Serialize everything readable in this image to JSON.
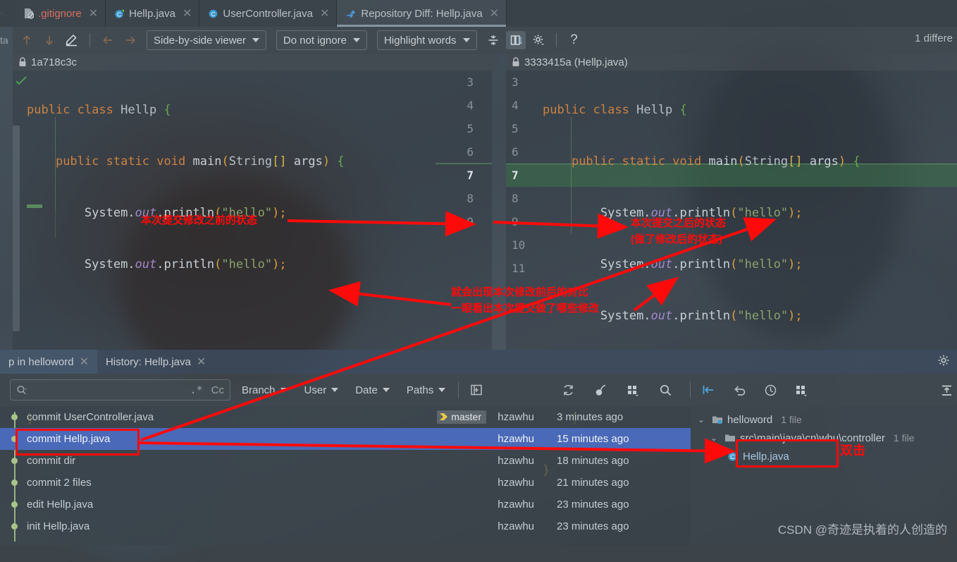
{
  "editor_tabs": [
    {
      "label": ".gitignore",
      "icon": "gitignore-file-icon",
      "active": false,
      "red": true
    },
    {
      "label": "Hellp.java",
      "icon": "java-class-icon",
      "active": false,
      "red": false
    },
    {
      "label": "UserController.java",
      "icon": "java-class-icon",
      "active": false,
      "red": false
    },
    {
      "label": "Repository Diff: Hellp.java",
      "icon": "diff-icon",
      "active": true,
      "red": false
    }
  ],
  "diff_toolbar": {
    "prev_diff": "prev-difference-icon",
    "next_diff": "next-difference-icon",
    "edit": "edit-source-icon",
    "back": "back-icon",
    "forward": "forward-icon",
    "viewer_mode": "Side-by-side viewer",
    "ignore_mode": "Do not ignore",
    "highlight_mode": "Highlight words",
    "collapse_unchanged": "collapse-unchanged-fragments-icon",
    "toggle_panes": "toggle-side-panes-icon",
    "settings": "gear-icon",
    "help": "?",
    "difference_count": "1 differe"
  },
  "revisions": {
    "left": {
      "lock_icon": "lock-icon",
      "label": "1a718c3c"
    },
    "right": {
      "lock_icon": "lock-icon",
      "label": "3333415a (Hellp.java)"
    }
  },
  "diff": {
    "left": {
      "line_numbers": [
        "3",
        "4",
        "5",
        "6",
        "7",
        "8",
        "9"
      ],
      "lines": [
        {
          "n": "3",
          "text": "public class Hellp {"
        },
        {
          "n": "4",
          "text": "    public static void main(String[] args) {"
        },
        {
          "n": "5",
          "text": "        System.out.println(\"hello\");"
        },
        {
          "n": "6",
          "text": "        System.out.println(\"hello\");"
        },
        {
          "n": "7",
          "text": ""
        },
        {
          "n": "8",
          "text": "    }"
        },
        {
          "n": "9",
          "text": "}"
        }
      ]
    },
    "right": {
      "line_numbers": [
        "3",
        "4",
        "5",
        "6",
        "7",
        "8",
        "9",
        "10",
        "11"
      ],
      "current_line": "7",
      "lines": [
        {
          "n": "3",
          "text": "public class Hellp {"
        },
        {
          "n": "4",
          "text": "    public static void main(String[] args) {"
        },
        {
          "n": "5",
          "text": "        System.out.println(\"hello\");"
        },
        {
          "n": "6",
          "text": "        System.out.println(\"hello\");"
        },
        {
          "n": "7",
          "text": "        System.out.println(\"hello\");"
        },
        {
          "n": "8",
          "text": ""
        },
        {
          "n": "9",
          "text": "    }"
        },
        {
          "n": "10",
          "text": "}"
        },
        {
          "n": "11",
          "text": ""
        }
      ]
    }
  },
  "bottom_tabs": [
    {
      "label": "p in helloword",
      "selected": true
    },
    {
      "label": "History: Hellp.java",
      "selected": false
    }
  ],
  "bottom_tabs_gear": "gear-icon",
  "log_toolbar": {
    "search_placeholder": "",
    "search_icon": "search-icon",
    "regex_label": ".*",
    "case_label": "Cc",
    "filters": [
      "Branch",
      "User",
      "Date",
      "Paths"
    ],
    "new_filter_icon": "add-filter-icon",
    "refresh_icon": "refresh-icon",
    "cherry_pick_icon": "cherry-pick-icon",
    "show_graph_icon": "show-graph-icon",
    "find_icon": "find-icon",
    "go_to_hash_icon": "go-to-hash-icon",
    "revert_icon": "revert-icon",
    "history_icon": "clock-icon",
    "group_icon": "group-icon",
    "expand_icon": "expand-collapse-icon"
  },
  "commits": [
    {
      "subject": "commit UserController.java",
      "tag": "master",
      "author": "hzawhu",
      "date": "3 minutes ago",
      "selected": false
    },
    {
      "subject": "commit Hellp.java",
      "tag": "",
      "author": "hzawhu",
      "date": "15 minutes ago",
      "selected": true
    },
    {
      "subject": "commit dir",
      "tag": "",
      "author": "hzawhu",
      "date": "18 minutes ago",
      "selected": false
    },
    {
      "subject": "commit 2 files",
      "tag": "",
      "author": "hzawhu",
      "date": "21 minutes ago",
      "selected": false
    },
    {
      "subject": "edit Hellp.java",
      "tag": "",
      "author": "hzawhu",
      "date": "23 minutes ago",
      "selected": false
    },
    {
      "subject": "init Hellp.java",
      "tag": "",
      "author": "hzawhu",
      "date": "23 minutes ago",
      "selected": false
    }
  ],
  "file_tree": [
    {
      "label": "helloword",
      "count": "1 file",
      "icon": "module-folder-icon",
      "level": 1,
      "chevron": "⌄"
    },
    {
      "label": "src\\main\\java\\cn\\whu\\controller",
      "count": "1 file",
      "icon": "folder-icon",
      "level": 2,
      "chevron": "⌄"
    },
    {
      "label": "Hellp.java",
      "count": "",
      "icon": "java-class-icon",
      "level": 3,
      "chevron": ""
    }
  ],
  "annotations": {
    "before_state": "本次提交修改之前的状态",
    "after_state_line1": "本次提交之后的状态",
    "after_state_line2": "(做了修改后的状态)",
    "compare_line1": "就会出现本次修改前后的对比",
    "compare_line2": "一眼看出本次提交做了哪些修改",
    "double_click": "双击"
  },
  "watermark": "CSDN @奇迹是执着的人创造的",
  "colors": {
    "accent_selection": "#4a69b8",
    "annotation_red": "#ff0a0a",
    "added_line_green": "#3d734b",
    "branch_dot": "#a9c48a"
  }
}
